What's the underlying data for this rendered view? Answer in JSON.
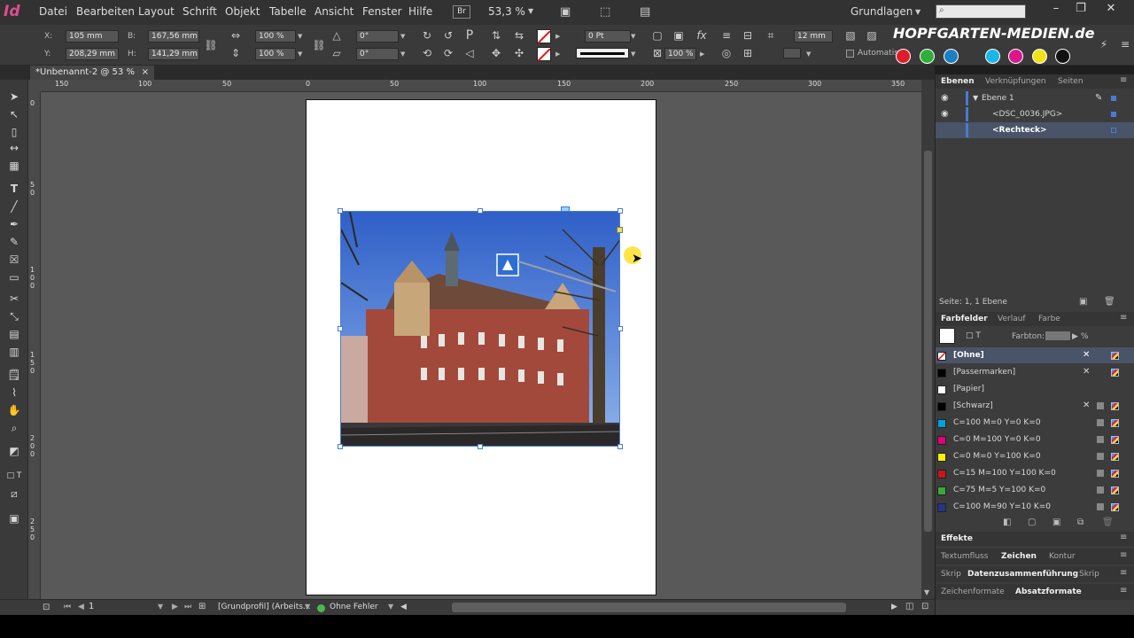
{
  "app": {
    "icon_text": "Id"
  },
  "menu": [
    "Datei",
    "Bearbeiten",
    "Layout",
    "Schrift",
    "Objekt",
    "Tabelle",
    "Ansicht",
    "Fenster",
    "Hilfe"
  ],
  "bridge_label": "Br",
  "zoom": "53,3 %",
  "workspace": "Grundlagen",
  "search_placeholder": "",
  "control": {
    "x_label": "X:",
    "x_value": "105 mm",
    "y_label": "Y:",
    "y_value": "208,29 mm",
    "b_label": "B:",
    "b_value": "167,56 mm",
    "h_label": "H:",
    "h_value": "141,29 mm",
    "scale_x": "100 %",
    "scale_y": "100 %",
    "rotate": "0°",
    "shear": "0°",
    "stroke_weight": "0 Pt",
    "opacity": "100 %",
    "size_field": "12 mm",
    "auto_fit": "Automatisch"
  },
  "watermark": "HOPFGARTEN-MEDIEN.de",
  "watermark_colors": [
    "#e01e2b",
    "#2fae3c",
    "#1d7fc2",
    "#1ab7e6",
    "#d8188c",
    "#f2e21a",
    "#111111"
  ],
  "doc_tab": "*Unbenannt-2 @ 53 %",
  "doc_tab_close": "×",
  "ruler_h": [
    "150",
    "100",
    "50",
    "0",
    "50",
    "100",
    "150",
    "200",
    "250",
    "300",
    "350"
  ],
  "ruler_v": [
    "0",
    "5 0",
    "1 0 0",
    "1 5 0",
    "2 0 0",
    "2 5 0"
  ],
  "layers_panel": {
    "tabs": [
      "Ebenen",
      "Verknüpfungen",
      "Seiten"
    ],
    "layer_name": "Ebene 1",
    "items": [
      "<DSC_0036.JPG>",
      "<Rechteck>"
    ],
    "footer": "Seite: 1, 1 Ebene"
  },
  "swatches_panel": {
    "tabs": [
      "Farbfelder",
      "Verlauf",
      "Farbe"
    ],
    "tint_label": "Farbton:",
    "tint_unit": "%",
    "items": [
      {
        "name": "[Ohne]",
        "color": "none"
      },
      {
        "name": "[Passermarken]",
        "color": "#000000"
      },
      {
        "name": "[Papier]",
        "color": "#ffffff"
      },
      {
        "name": "[Schwarz]",
        "color": "#000000"
      },
      {
        "name": "C=100 M=0 Y=0 K=0",
        "color": "#00a0e0"
      },
      {
        "name": "C=0 M=100 Y=0 K=0",
        "color": "#e0007a"
      },
      {
        "name": "C=0 M=0 Y=100 K=0",
        "color": "#fff000"
      },
      {
        "name": "C=15 M=100 Y=100 K=0",
        "color": "#c8161d"
      },
      {
        "name": "C=75 M=5 Y=100 K=0",
        "color": "#3aa935"
      },
      {
        "name": "C=100 M=90 Y=10 K=0",
        "color": "#293487"
      }
    ]
  },
  "lower_panels": {
    "effects": "Effekte",
    "row1": [
      "Textumfluss",
      "Zeichen",
      "Kontur"
    ],
    "row2": [
      "Skrip",
      "Datenzusammenführung",
      "Skrip"
    ],
    "row3": [
      "Zeichenformate",
      "Absatzformate"
    ]
  },
  "status": {
    "page": "1",
    "profile": "[Grundprofil] (Arbeits...",
    "errors": "Ohne Fehler"
  }
}
